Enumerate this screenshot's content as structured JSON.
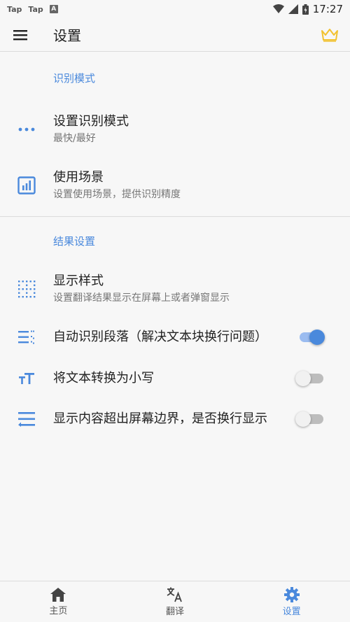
{
  "status_bar": {
    "left_labels": [
      "Tap",
      "Tap"
    ],
    "app_icon_letter": "A",
    "time": "17:27"
  },
  "app_bar": {
    "title": "设置",
    "menu_icon": "hamburger-icon",
    "premium_icon": "crown-icon"
  },
  "sections": [
    {
      "header": "识别模式",
      "items": [
        {
          "icon": "more-horizontal-icon",
          "title": "设置识别模式",
          "subtitle": "最快/最好"
        },
        {
          "icon": "bar-chart-icon",
          "title": "使用场景",
          "subtitle": "设置使用场景，提供识别精度"
        }
      ]
    },
    {
      "header": "结果设置",
      "items": [
        {
          "icon": "dotted-grid-icon",
          "title": "显示样式",
          "subtitle": "设置翻译结果显示在屏幕上或者弹窗显示"
        }
      ],
      "toggles": [
        {
          "icon": "paragraph-list-icon",
          "title": "自动识别段落（解决文本块换行问题）",
          "on": true
        },
        {
          "icon": "text-size-icon",
          "title": "将文本转换为小写",
          "on": false
        },
        {
          "icon": "wrap-text-icon",
          "title": "显示内容超出屏幕边界，是否换行显示",
          "on": false
        }
      ]
    }
  ],
  "bottom_nav": [
    {
      "icon": "home-icon",
      "label": "主页",
      "active": false
    },
    {
      "icon": "translate-icon",
      "label": "翻译",
      "active": false
    },
    {
      "icon": "gear-icon",
      "label": "设置",
      "active": true
    }
  ],
  "colors": {
    "accent": "#4a89dc",
    "crown": "#f2c230",
    "background": "#f7f7f7"
  }
}
